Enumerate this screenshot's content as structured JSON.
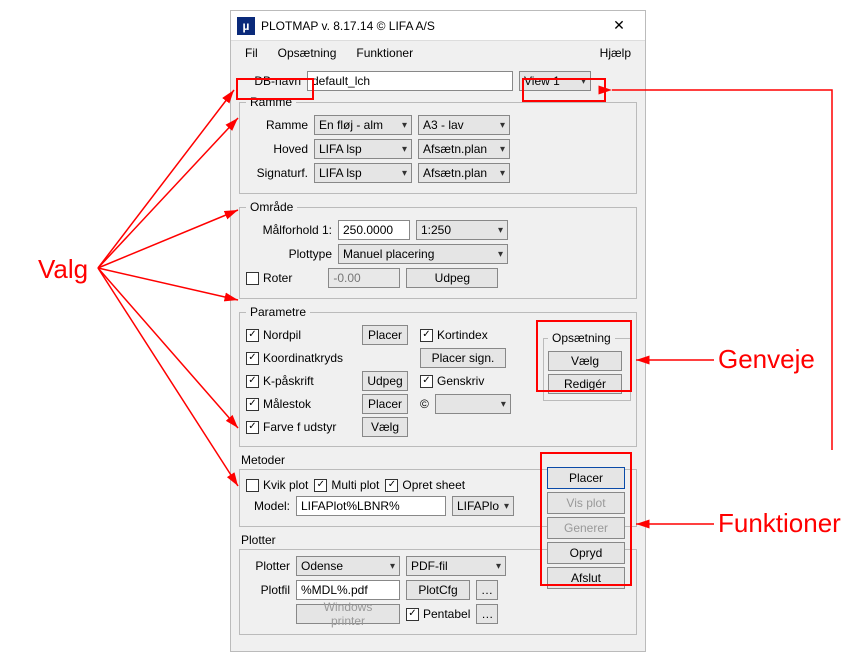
{
  "window": {
    "title": "PLOTMAP v. 8.17.14 © LIFA A/S"
  },
  "menu": {
    "fil": "Fil",
    "opsaetning": "Opsætning",
    "funktioner": "Funktioner",
    "hjaelp": "Hjælp"
  },
  "top": {
    "db_label": "DB-navn",
    "db_value": "default_lch",
    "view": "View 1"
  },
  "ramme": {
    "legend": "Ramme",
    "ramme_label": "Ramme",
    "ramme_val1": "En fløj - alm",
    "ramme_val2": "A3 - lav",
    "hoved_label": "Hoved",
    "hoved_val1": "LIFA lsp",
    "hoved_val2": "Afsætn.plan",
    "signatur_label": "Signaturf.",
    "signatur_val1": "LIFA lsp",
    "signatur_val2": "Afsætn.plan"
  },
  "omraade": {
    "legend": "Område",
    "maal_label": "Målforhold 1:",
    "maal_value": "250.0000",
    "maal_select": "1:250",
    "plottype_label": "Plottype",
    "plottype_value": "Manuel placering",
    "roter_label": "Roter",
    "roter_value": "-0.00",
    "udpeg": "Udpeg"
  },
  "parametre": {
    "legend": "Parametre",
    "nordpil": "Nordpil",
    "koordinatkryds": "Koordinatkryds",
    "kpaaskrift": "K-påskrift",
    "maalestok": "Målestok",
    "farve": "Farve f udstyr",
    "kortindex": "Kortindex",
    "genskriv": "Genskriv",
    "copyright": "©",
    "btn_placer": "Placer",
    "btn_udpeg": "Udpeg",
    "btn_vaelg": "Vælg",
    "btn_placer_sign": "Placer sign."
  },
  "opsaetning": {
    "legend": "Opsætning",
    "vaelg": "Vælg",
    "rediger": "Redigér"
  },
  "metoder": {
    "legend": "Metoder",
    "kvik": "Kvik plot",
    "multi": "Multi plot",
    "opret": "Opret sheet",
    "model_label": "Model:",
    "model_value": "LIFAPlot%LBNR%",
    "model_combo": "LIFAPlo"
  },
  "plotter": {
    "legend": "Plotter",
    "plotter_label": "Plotter",
    "plotter_val1": "Odense",
    "plotter_val2": "PDF-fil",
    "plotfil_label": "Plotfil",
    "plotfil_value": "%MDL%.pdf",
    "plotcfg": "PlotCfg",
    "winprinter": "Windows printer",
    "pentabel": "Pentabel"
  },
  "actions": {
    "placer": "Placer",
    "visplot": "Vis plot",
    "generer": "Generer",
    "opryd": "Opryd",
    "afslut": "Afslut"
  },
  "annotations": {
    "valg": "Valg",
    "genveje": "Genveje",
    "funktioner": "Funktioner"
  }
}
